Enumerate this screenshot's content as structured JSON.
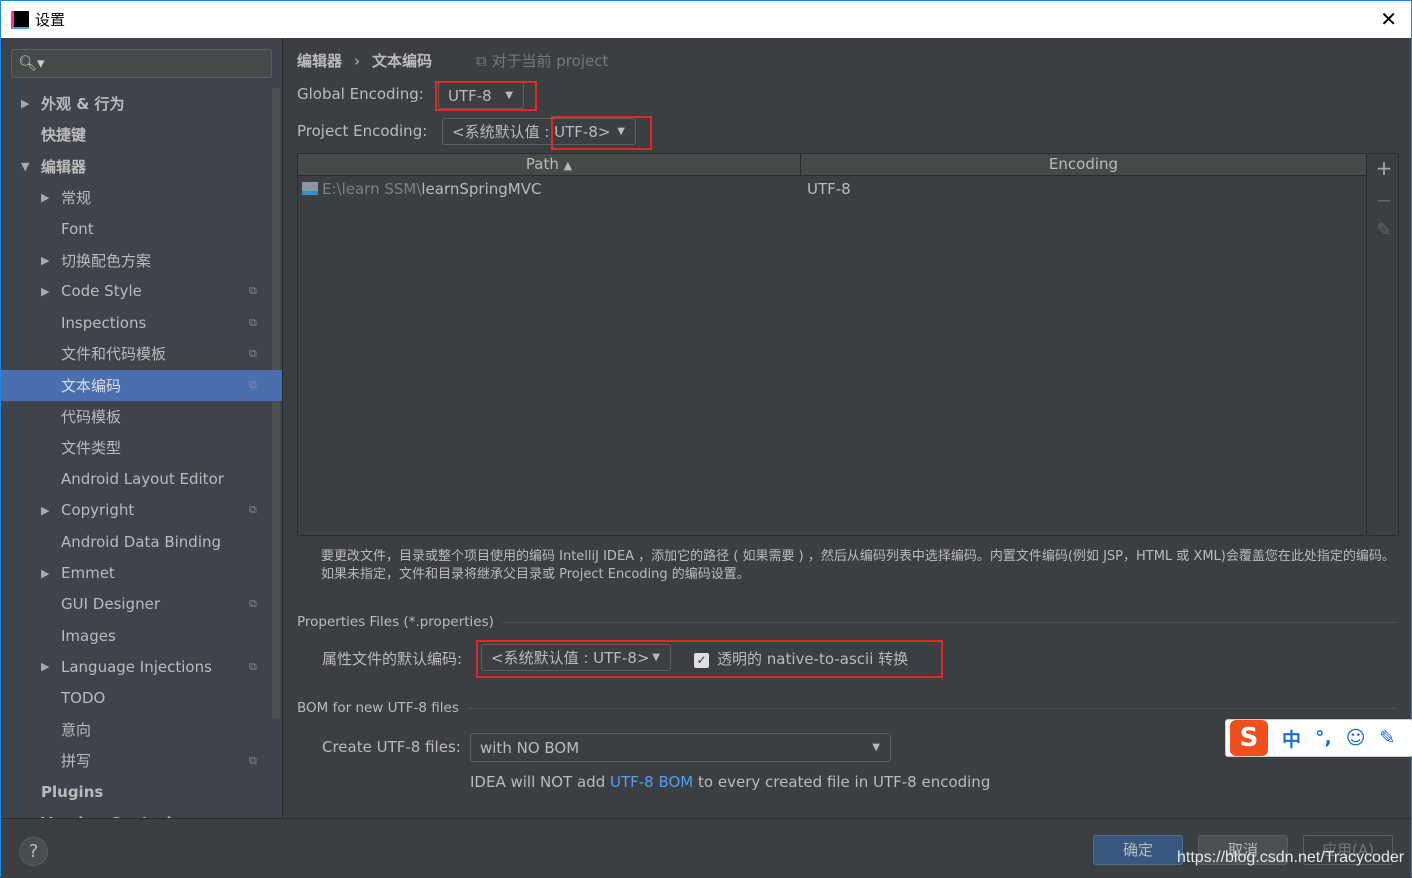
{
  "window": {
    "title": "设置",
    "logo": "IJ"
  },
  "sidebar": {
    "search_placeholder": "",
    "items": [
      {
        "label": "外观 & 行为",
        "level": 0,
        "arrow": "right",
        "bold": true
      },
      {
        "label": "快捷键",
        "level": 0,
        "arrow": "",
        "bold": true
      },
      {
        "label": "编辑器",
        "level": 0,
        "arrow": "down",
        "bold": true
      },
      {
        "label": "常规",
        "level": 1,
        "arrow": "right"
      },
      {
        "label": "Font",
        "level": 1,
        "arrow": ""
      },
      {
        "label": "切换配色方案",
        "level": 1,
        "arrow": "right"
      },
      {
        "label": "Code Style",
        "level": 1,
        "arrow": "right",
        "copy": true
      },
      {
        "label": "Inspections",
        "level": 1,
        "arrow": "",
        "copy": true
      },
      {
        "label": "文件和代码模板",
        "level": 1,
        "arrow": "",
        "copy": true
      },
      {
        "label": "文本编码",
        "level": 1,
        "arrow": "",
        "copy": true,
        "selected": true
      },
      {
        "label": "代码模板",
        "level": 1,
        "arrow": ""
      },
      {
        "label": "文件类型",
        "level": 1,
        "arrow": ""
      },
      {
        "label": "Android Layout Editor",
        "level": 1,
        "arrow": ""
      },
      {
        "label": "Copyright",
        "level": 1,
        "arrow": "right",
        "copy": true
      },
      {
        "label": "Android Data Binding",
        "level": 1,
        "arrow": ""
      },
      {
        "label": "Emmet",
        "level": 1,
        "arrow": "right"
      },
      {
        "label": "GUI Designer",
        "level": 1,
        "arrow": "",
        "copy": true
      },
      {
        "label": "Images",
        "level": 1,
        "arrow": ""
      },
      {
        "label": "Language Injections",
        "level": 1,
        "arrow": "right",
        "copy": true
      },
      {
        "label": "TODO",
        "level": 1,
        "arrow": ""
      },
      {
        "label": "意向",
        "level": 1,
        "arrow": ""
      },
      {
        "label": "拼写",
        "level": 1,
        "arrow": "",
        "copy": true
      },
      {
        "label": "Plugins",
        "level": 0,
        "arrow": "",
        "bold": true
      },
      {
        "label": "Version Control",
        "level": 0,
        "arrow": "right",
        "bold": true,
        "copy": true
      }
    ]
  },
  "breadcrumb": {
    "parent": "编辑器",
    "current": "文本编码",
    "scope": "对于当前 project"
  },
  "global_encoding": {
    "label": "Global Encoding:",
    "value": "UTF-8"
  },
  "project_encoding": {
    "label": "Project Encoding:",
    "value": "<系统默认值 : UTF-8>"
  },
  "table": {
    "columns": [
      "Path",
      "Encoding"
    ],
    "sort": "Path ascending",
    "rows": [
      {
        "path_prefix": "E:\\learn SSM\\",
        "path_name": "learnSpringMVC",
        "encoding": "UTF-8"
      }
    ]
  },
  "table_tools": {
    "add": "+",
    "remove": "−",
    "edit": "✎"
  },
  "hint": "要更改文件，目录或整个项目使用的编码 IntelliJ IDEA ，添加它的路径 ( 如果需要 ) ，然后从编码列表中选择编码。内置文件编码(例如 JSP，HTML 或 XML)会覆盖您在此处指定的编码。如果未指定，文件和目录将继承父目录或 Project Encoding 的编码设置。",
  "properties": {
    "section": "Properties Files (*.properties)",
    "label": "属性文件的默认编码:",
    "value": "<系统默认值 : UTF-8>",
    "native_label": "透明的 native-to-ascii 转换",
    "native_checked": true
  },
  "bom": {
    "section": "BOM for new UTF-8 files",
    "label": "Create UTF-8 files:",
    "value": "with NO BOM",
    "note_pre": "IDEA will NOT add ",
    "note_link": "UTF-8 BOM",
    "note_post": " to every created file in UTF-8 encoding"
  },
  "footer": {
    "ok": "确定",
    "cancel": "取消",
    "apply": "应用(A)",
    "help": "?"
  },
  "ime": {
    "logo": "S",
    "mode": "中",
    "punct": "°,",
    "emoji": "☺",
    "pen": "✎"
  },
  "watermark": "https://blog.csdn.net/Tracycoder",
  "colors": {
    "accent": "#4b6eaf",
    "link": "#589df6",
    "highlight_box": "#e8262a"
  }
}
